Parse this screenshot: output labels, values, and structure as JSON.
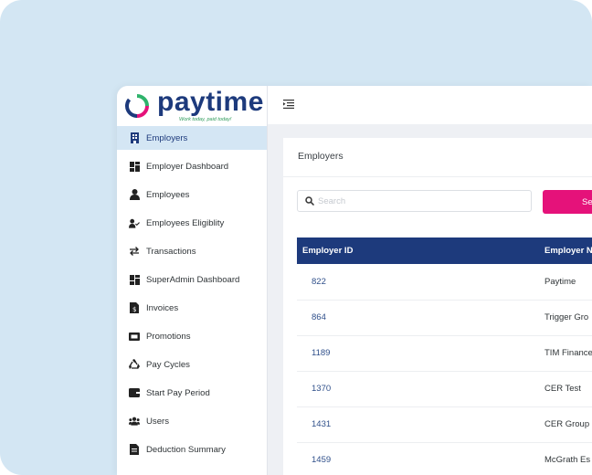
{
  "brand": {
    "name": "paytime",
    "tagline": "Work today, paid today!",
    "logo_blue": "#1d3a7c",
    "logo_ring_colors": [
      "#2fb36b",
      "#e5127a",
      "#1d3a7c"
    ]
  },
  "sidebar": {
    "items": [
      {
        "label": "Employers",
        "icon": "building-icon",
        "active": true
      },
      {
        "label": "Employer Dashboard",
        "icon": "dashboard-icon"
      },
      {
        "label": "Employees",
        "icon": "person-icon"
      },
      {
        "label": "Employees Eligiblity",
        "icon": "person-check-icon"
      },
      {
        "label": "Transactions",
        "icon": "arrows-exchange-icon"
      },
      {
        "label": "SuperAdmin Dashboard",
        "icon": "dashboard-icon"
      },
      {
        "label": "Invoices",
        "icon": "invoice-icon"
      },
      {
        "label": "Promotions",
        "icon": "ticket-icon"
      },
      {
        "label": "Pay Cycles",
        "icon": "recycle-icon"
      },
      {
        "label": "Start Pay Period",
        "icon": "wallet-icon"
      },
      {
        "label": "Users",
        "icon": "users-icon"
      },
      {
        "label": "Deduction Summary",
        "icon": "document-icon"
      }
    ]
  },
  "main": {
    "title": "Employers",
    "search": {
      "placeholder": "Search",
      "button_label": "Se"
    },
    "table": {
      "columns": [
        "Employer ID",
        "Employer N"
      ],
      "rows": [
        {
          "id": "822",
          "name": "Paytime"
        },
        {
          "id": "864",
          "name": "Trigger Gro"
        },
        {
          "id": "1189",
          "name": "TIM Finance"
        },
        {
          "id": "1370",
          "name": "CER Test"
        },
        {
          "id": "1431",
          "name": "CER Group"
        },
        {
          "id": "1459",
          "name": "McGrath Es"
        }
      ]
    }
  },
  "colors": {
    "accent_pink": "#e5127a",
    "header_navy": "#1d3a7c",
    "active_nav": "#d4e6f4",
    "backdrop": "#d3e6f3"
  }
}
